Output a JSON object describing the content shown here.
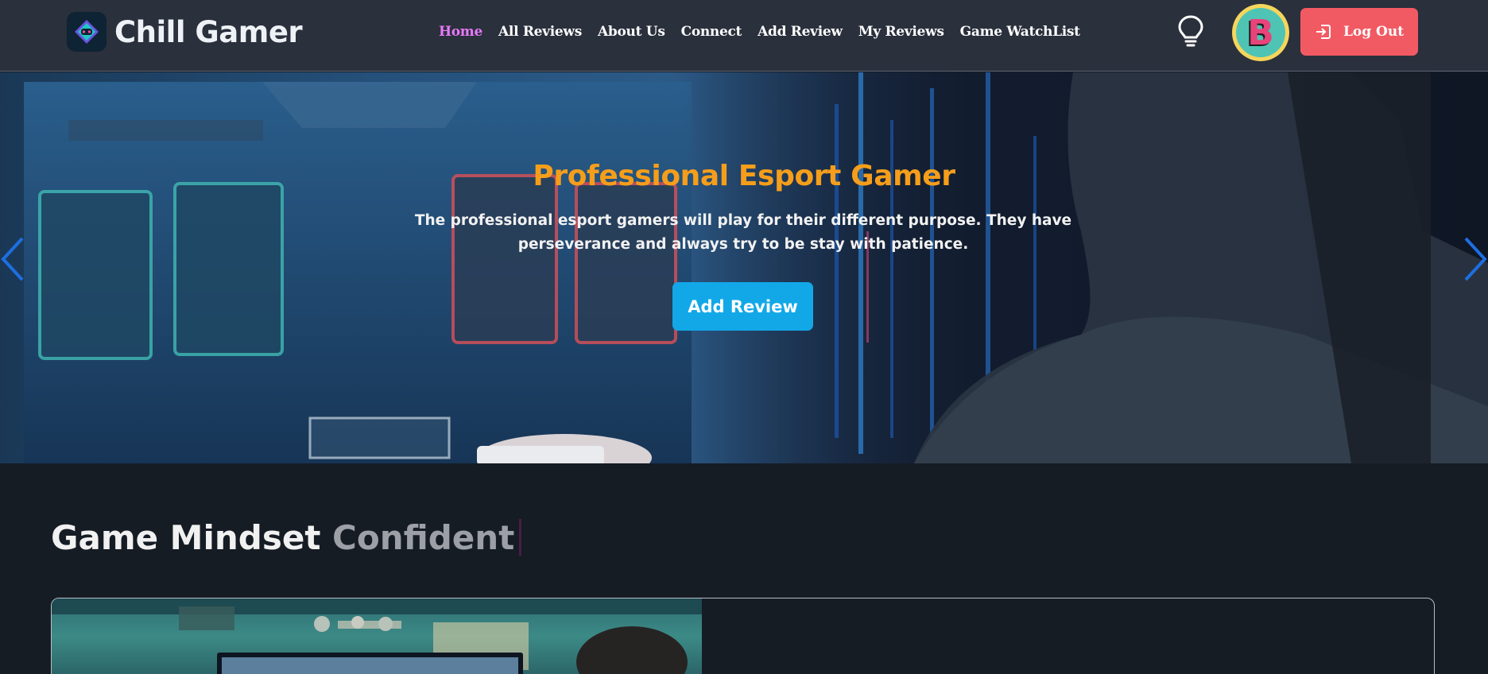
{
  "navbar": {
    "brand_name": "Chill Gamer",
    "logo_icon": "gamepad-icon",
    "links": [
      "Home",
      "All Reviews",
      "About Us",
      "Connect",
      "Add Review",
      "My Reviews",
      "Game WatchList"
    ],
    "active_link": "Home",
    "theme_toggle_icon": "lightbulb-icon",
    "avatar_letter": "B",
    "logout_label": "Log Out",
    "logout_icon": "logout-icon"
  },
  "hero": {
    "title": "Professional Esport Gamer",
    "description": "The professional esport gamers will play for their different purpose. They have perseverance and always try to be stay with patience.",
    "cta_label": "Add Review",
    "prev_icon": "chevron-left-icon",
    "next_icon": "chevron-right-icon"
  },
  "section": {
    "heading_static": "Game Mindset",
    "heading_typed": "Confident"
  },
  "colors": {
    "navbar_bg": "#2a303c",
    "page_bg": "#161c24",
    "active_link": "#e879f9",
    "hero_title": "#f59e1b",
    "cta_bg": "#12a8e8",
    "logout_bg": "#f25a63",
    "carousel_arrow": "#1d6fe0"
  }
}
